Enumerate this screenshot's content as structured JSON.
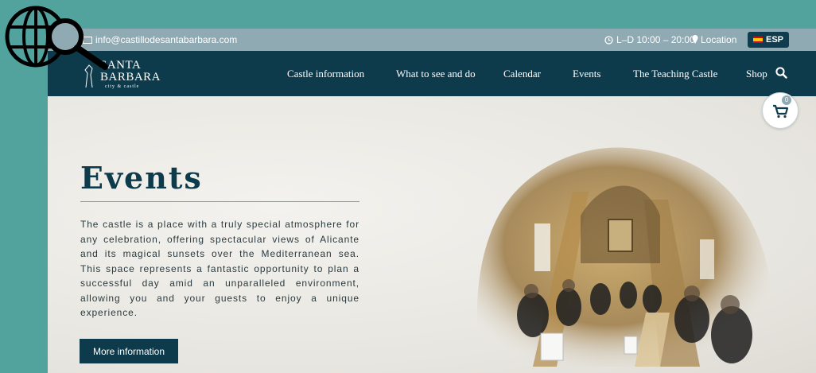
{
  "topbar": {
    "email": "info@castillodesantabarbara.com",
    "hours": "L–D 10:00 – 20:00",
    "location_label": "Location",
    "language_label": "ESP"
  },
  "logo": {
    "line1": "SANTA",
    "line2": "BARBARA",
    "tagline": "city & castle"
  },
  "nav": {
    "items": [
      "Castle information",
      "What to see and do",
      "Calendar",
      "Events",
      "The Teaching Castle",
      "Shop"
    ]
  },
  "cart": {
    "count": "0"
  },
  "hero": {
    "title": "Events",
    "text": "The castle is a place with a truly special atmosphere for any celebration, offering spectacular views of Alicante and its magical sunsets over the Mediterranean sea. This space represents a fantastic opportunity to plan a successful day amid an unparalleled environment, allowing you and your guests to enjoy a unique experience.",
    "button_label": "More information"
  },
  "colors": {
    "background_teal": "#52a39e",
    "topbar": "#8faab3",
    "navbar": "#0e3b4c",
    "accent": "#0e3b4c"
  }
}
